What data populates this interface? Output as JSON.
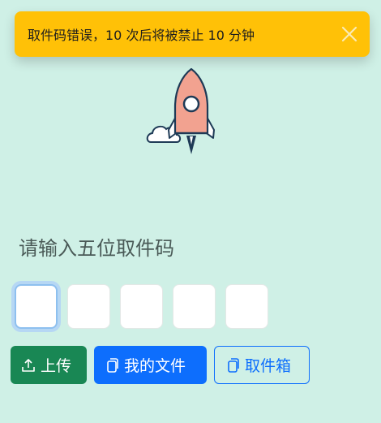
{
  "toast": {
    "message": "取件码错误，10 次后将被禁止 10 分钟",
    "close_icon": "close-icon",
    "background": "#ffc107"
  },
  "illustration": {
    "icon": "rocket-icon"
  },
  "prompt": {
    "label": "请输入五位取件码"
  },
  "code_inputs": [
    {
      "value": "",
      "focused": true
    },
    {
      "value": "",
      "focused": false
    },
    {
      "value": "",
      "focused": false
    },
    {
      "value": "",
      "focused": false
    },
    {
      "value": "",
      "focused": false
    }
  ],
  "actions": {
    "upload": {
      "label": "上传",
      "icon": "upload-icon",
      "color": "#198754"
    },
    "my_files": {
      "label": "我的文件",
      "icon": "copy-icon",
      "color": "#0d6efd"
    },
    "pickup_box": {
      "label": "取件箱",
      "icon": "copy-icon",
      "color": "#0d6efd"
    }
  }
}
